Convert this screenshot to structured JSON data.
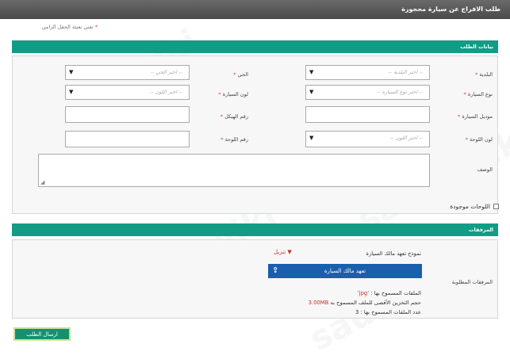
{
  "page": {
    "title": "طلب الافراج عن سيارة محجوزة",
    "required_note": "تعني تعبئة الحقل الزامي",
    "required_star": "*"
  },
  "section1": {
    "title": "بيانات الطلب",
    "municipality_label": "البلدية",
    "municipality_placeholder": "-- اختر البلدية --",
    "district_label": "الحي",
    "district_placeholder": "-- اختر الحي --",
    "car_type_label": "نوع السيارة",
    "car_type_placeholder": "-- اختر نوع السيارة --",
    "car_color_label": "لون السيارة",
    "car_color_placeholder": "-- اختر اللون --",
    "car_model_label": "موديل السيارة",
    "chassis_label": "رقم الهيكل",
    "plate_color_label": "لون اللوحة",
    "plate_color_placeholder": "-- اختر اللون --",
    "plate_number_label": "رقم اللوحة",
    "description_label": "الوصف",
    "plates_present_label": "اللوحات موجودة",
    "select_arrow": "▼",
    "resize_grip": "◢"
  },
  "section2": {
    "title": "المرفقات",
    "required_attachments_label": "المرفقات المطلوبة",
    "form_title": "نموذج تعهد مالك السيارة",
    "download_label": "تنزيل",
    "upload_button": "تعهد مالك السيارة",
    "upload_icon": "⇪",
    "allowed_files_label": "الملفات المسموح بها :",
    "allowed_files_value": "'jpg'",
    "max_size_label": "حجم التخزين الأقصى للملف المسموح به",
    "max_size_value": "3.00MB",
    "file_count_label": "عدد الملفات المسموح بها :",
    "file_count_value": "3"
  },
  "actions": {
    "submit": "ارسال الطلب"
  },
  "watermark": "saudi.wiki"
}
